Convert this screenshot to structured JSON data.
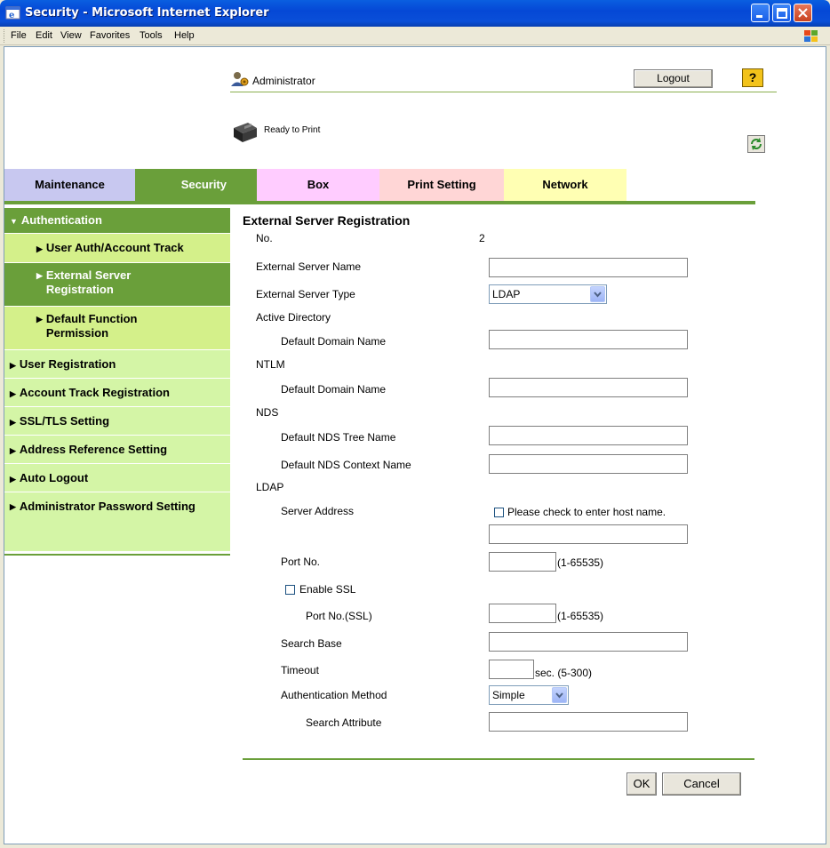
{
  "window": {
    "title": "Security - Microsoft Internet Explorer"
  },
  "menu": [
    "File",
    "Edit",
    "View",
    "Favorites",
    "Tools",
    "Help"
  ],
  "header": {
    "user": "Administrator",
    "logout": "Logout",
    "help": "?",
    "status": "Ready to Print"
  },
  "tabs": [
    {
      "label": "Maintenance",
      "color": "#c8c8f0"
    },
    {
      "label": "Security",
      "color": "#6a9f3a",
      "active": true
    },
    {
      "label": "Box",
      "color": "#ffccff"
    },
    {
      "label": "Print Setting",
      "color": "#ffd6d6"
    },
    {
      "label": "Network",
      "color": "#ffffb3"
    }
  ],
  "sidebar": {
    "items": [
      {
        "label": "Authentication"
      },
      {
        "label": "User Auth/Account Track"
      },
      {
        "label": "External Server Registration"
      },
      {
        "label": "Default Function Permission"
      },
      {
        "label": "User Registration"
      },
      {
        "label": "Account Track Registration"
      },
      {
        "label": "SSL/TLS Setting"
      },
      {
        "label": "Address Reference Setting"
      },
      {
        "label": "Auto Logout"
      },
      {
        "label": "Administrator Password Setting"
      }
    ]
  },
  "form": {
    "title": "External Server Registration",
    "no_label": "No.",
    "no_value": "2",
    "server_name_label": "External Server Name",
    "server_name_value": "",
    "server_type_label": "External Server Type",
    "server_type_value": "LDAP",
    "ad_label": "Active Directory",
    "ad_domain_label": "Default Domain Name",
    "ntlm_label": "NTLM",
    "ntlm_domain_label": "Default Domain Name",
    "nds_label": "NDS",
    "nds_tree_label": "Default NDS Tree Name",
    "nds_context_label": "Default NDS Context Name",
    "ldap_label": "LDAP",
    "server_address_label": "Server Address",
    "host_check_label": "Please check to enter host name.",
    "port_label": "Port No.",
    "port_range": "(1-65535)",
    "ssl_label": "Enable SSL",
    "ssl_port_label": "Port No.(SSL)",
    "ssl_port_range": "(1-65535)",
    "search_base_label": "Search Base",
    "timeout_label": "Timeout",
    "timeout_unit": "sec. (5-300)",
    "auth_method_label": "Authentication Method",
    "auth_method_value": "Simple",
    "search_attr_label": "Search Attribute",
    "ok": "OK",
    "cancel": "Cancel"
  }
}
